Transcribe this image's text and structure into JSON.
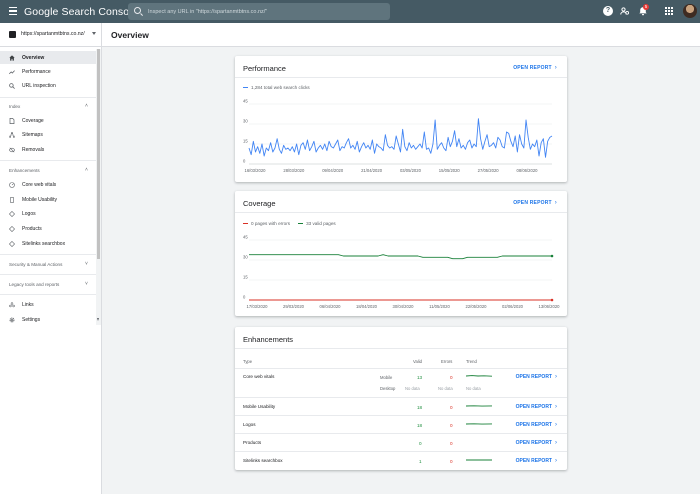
{
  "app": {
    "brand": "Google Search Console"
  },
  "search": {
    "placeholder": "Inspect any URL in \"https://spartanmtbtns.co.nz/\""
  },
  "topbar": {
    "help": "?",
    "notifications_count": "5"
  },
  "property": {
    "label": "https://spartanmtbtns.co.nz/"
  },
  "page": {
    "title": "Overview"
  },
  "sidebar": {
    "items": [
      {
        "label": "Overview",
        "icon": "home-icon"
      },
      {
        "label": "Performance",
        "icon": "trending-up-icon"
      },
      {
        "label": "URL inspection",
        "icon": "search-icon"
      }
    ],
    "index": {
      "label": "Index",
      "items": [
        {
          "label": "Coverage",
          "icon": "file-icon"
        },
        {
          "label": "Sitemaps",
          "icon": "sitemap-icon"
        },
        {
          "label": "Removals",
          "icon": "eye-off-icon"
        }
      ]
    },
    "enhancements": {
      "label": "Enhancements",
      "items": [
        {
          "label": "Core web vitals",
          "icon": "gauge-icon"
        },
        {
          "label": "Mobile Usability",
          "icon": "phone-icon"
        },
        {
          "label": "Logos",
          "icon": "diamond-icon"
        },
        {
          "label": "Products",
          "icon": "diamond-icon"
        },
        {
          "label": "Sitelinks searchbox",
          "icon": "diamond-icon"
        }
      ]
    },
    "security": {
      "label": "Security & Manual Actions"
    },
    "legacy": {
      "label": "Legacy tools and reports"
    },
    "bottom": [
      {
        "label": "Links",
        "icon": "link-icon"
      },
      {
        "label": "Settings",
        "icon": "gear-icon"
      }
    ]
  },
  "performance": {
    "title": "Performance",
    "open_report": "OPEN REPORT",
    "legend": "1,284 total web search clicks",
    "color": "#4285f4",
    "chart_data": {
      "type": "line",
      "yticks": [
        "45",
        "30",
        "15",
        "0"
      ],
      "ylim": [
        0,
        45
      ],
      "xticks": [
        "16/03/2020",
        "28/03/2020",
        "09/04/2020",
        "21/04/2020",
        "03/05/2020",
        "15/05/2020",
        "27/05/2020",
        "08/06/2020"
      ],
      "series": [
        {
          "name": "1,284 total web search clicks",
          "values": [
            12,
            7,
            17,
            9,
            13,
            8,
            15,
            6,
            12,
            10,
            16,
            9,
            12,
            19,
            11,
            8,
            14,
            11,
            12,
            10,
            13,
            9,
            15,
            7,
            14,
            16,
            11,
            18,
            10,
            13,
            17,
            9,
            12,
            14,
            11,
            15,
            10,
            17,
            13,
            12,
            15,
            18,
            10,
            13,
            12,
            16,
            19,
            12,
            14,
            11,
            17,
            9,
            13,
            16,
            12,
            14,
            11,
            18,
            8,
            15,
            13,
            12,
            10,
            22,
            14,
            12,
            13,
            11,
            21,
            15,
            9,
            26,
            13,
            10,
            16,
            12,
            14,
            11,
            13,
            15,
            12,
            24,
            11,
            12,
            8,
            15,
            33,
            11,
            14,
            16,
            12,
            10,
            20,
            13,
            17,
            25,
            13,
            19,
            12,
            14,
            11,
            16,
            18,
            12,
            15,
            13,
            34,
            19,
            11,
            17,
            22,
            13,
            14,
            16,
            12,
            20,
            18,
            13,
            12,
            24,
            23,
            17,
            13,
            21,
            9,
            22,
            15,
            12,
            33,
            20,
            11,
            15,
            13,
            18,
            6,
            16,
            19,
            5,
            17,
            20,
            21
          ]
        }
      ]
    }
  },
  "coverage": {
    "title": "Coverage",
    "open_report": "OPEN REPORT",
    "legend_errors": "0 pages with errors",
    "legend_valid": "33 valid pages",
    "color_errors": "#d93025",
    "color_valid": "#188038",
    "chart_data": {
      "type": "line",
      "yticks": [
        "45",
        "30",
        "15",
        "0"
      ],
      "ylim": [
        0,
        45
      ],
      "xticks": [
        "17/03/2020",
        "29/03/2020",
        "06/04/2020",
        "18/04/2020",
        "30/04/2020",
        "11/05/2020",
        "22/05/2020",
        "02/06/2020",
        "13/06/2020"
      ],
      "series": [
        {
          "name": "33 valid pages",
          "values": [
            34,
            34,
            34,
            34,
            34,
            34,
            34,
            34,
            34,
            34,
            34,
            34,
            34,
            34,
            34,
            34,
            34,
            34,
            34,
            33,
            33,
            33,
            33,
            33,
            33,
            33,
            33,
            34,
            33,
            33,
            33,
            33,
            33,
            33,
            33,
            32,
            32,
            32,
            32,
            32,
            32,
            31,
            31,
            31,
            32,
            32,
            32,
            32,
            32,
            32,
            32,
            33,
            33,
            33,
            33,
            33,
            33,
            33,
            33,
            33,
            33,
            33
          ]
        },
        {
          "name": "0 pages with errors",
          "values": [
            0,
            0,
            0,
            0,
            0,
            0,
            0,
            0,
            0,
            0,
            0,
            0,
            0,
            0,
            0,
            0,
            0,
            0,
            0,
            0,
            0,
            0,
            0,
            0,
            0,
            0,
            0,
            0,
            0,
            0,
            0,
            0,
            0,
            0,
            0,
            0,
            0,
            0,
            0,
            0,
            0,
            0,
            0,
            0,
            0,
            0,
            0,
            0,
            0,
            0,
            0,
            0,
            0,
            0,
            0,
            0,
            0,
            0,
            0,
            0,
            0,
            0
          ]
        }
      ]
    }
  },
  "enhancements": {
    "title": "Enhancements",
    "headers": {
      "type": "Type",
      "valid": "Valid",
      "errors": "Errors",
      "trend": "Trend"
    },
    "open_report": "OPEN REPORT",
    "rows": [
      {
        "type": "Core web vitals",
        "sub1": "Mobile",
        "valid1": "13",
        "errors1": "0",
        "sub2": "Desktop",
        "valid2": "No data",
        "errors2": "No data",
        "trend2": "No data"
      },
      {
        "type": "Mobile Usability",
        "valid": "18",
        "errors": "0"
      },
      {
        "type": "Logos",
        "valid": "18",
        "errors": "0"
      },
      {
        "type": "Products",
        "valid": "0",
        "errors": "0"
      },
      {
        "type": "Sitelinks searchbox",
        "valid": "1",
        "errors": "0"
      }
    ]
  }
}
